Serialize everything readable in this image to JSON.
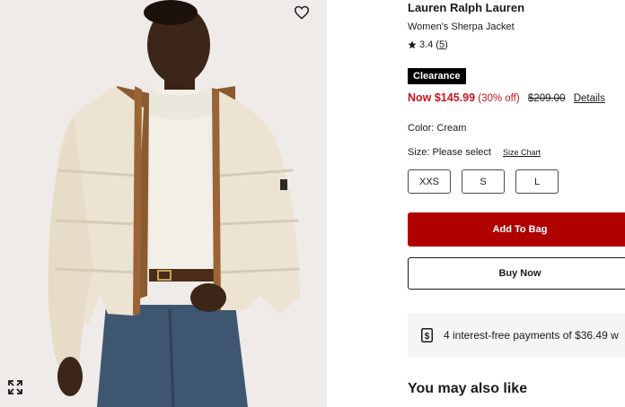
{
  "product": {
    "brand": "Lauren Ralph Lauren",
    "name": "Women's Sherpa Jacket",
    "rating_value": "3.4",
    "rating_count": "5",
    "badge": "Clearance",
    "price_now": "Now $145.99",
    "discount": "(30% off)",
    "price_original": "$209.00",
    "details_link": "Details",
    "color_label": "Color: Cream",
    "size_label": "Size: Please select",
    "size_chart_link": "Size Chart",
    "sizes": [
      "XXS",
      "S",
      "L"
    ]
  },
  "actions": {
    "add_to_bag": "Add To Bag",
    "buy_now": "Buy Now"
  },
  "payment": {
    "text": "4 interest-free payments of $36.49 w"
  },
  "recommendations": {
    "heading": "You may also like"
  },
  "colors": {
    "accent_red": "#b00000",
    "price_red": "#c9141d",
    "image_bg": "#eeebe8",
    "jacket": "#ece3d2"
  },
  "icons": {
    "favorite": "heart-icon",
    "expand": "expand-icon",
    "rating": "star-icon",
    "payment": "dollar-icon"
  }
}
